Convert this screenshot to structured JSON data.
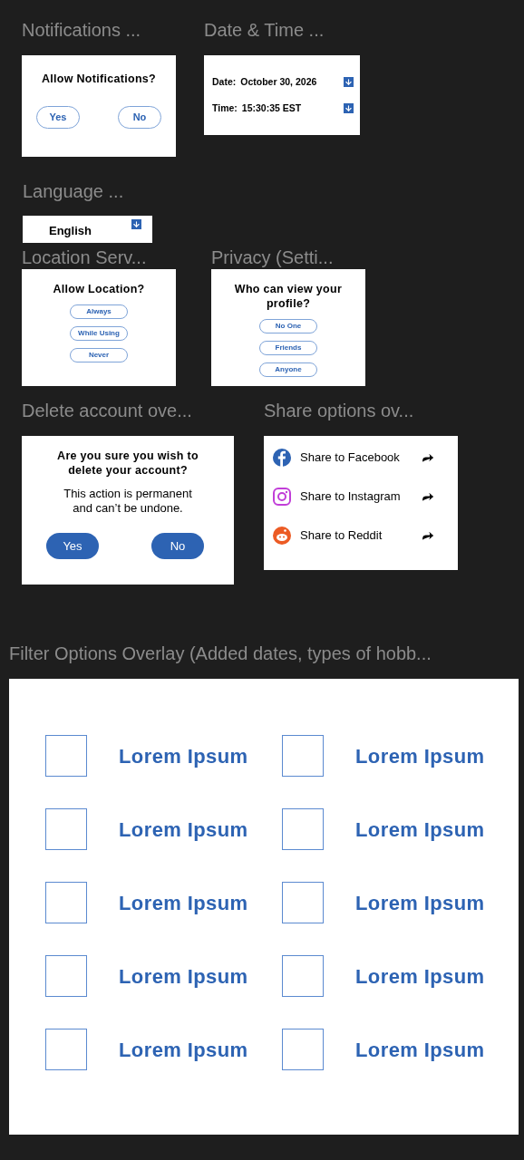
{
  "rows": [
    [
      {
        "kind": "confirm",
        "label": "Notifications ...",
        "title": "Allow Notifications?",
        "buttons": [
          "Yes",
          "No"
        ]
      },
      {
        "kind": "datetime",
        "label": "Date & Time ...",
        "fields": [
          {
            "name": "Date:",
            "value": "October 30, 2026"
          },
          {
            "name": "Time:",
            "value": "15:30:35 EST"
          }
        ]
      }
    ],
    [
      {
        "kind": "dropdown",
        "label": "Language ...",
        "value": "English"
      }
    ],
    [
      {
        "kind": "choices",
        "label": "Location Serv...",
        "title": "Allow Location?",
        "options": [
          "Always",
          "While Using",
          "Never"
        ]
      },
      {
        "kind": "choices",
        "label": "Privacy (Setti...",
        "title": "Who can view your profile?",
        "options": [
          "No One",
          "Friends",
          "Anyone"
        ]
      }
    ],
    [
      {
        "kind": "delete",
        "label": "Delete account ove...",
        "title": "Are you sure you wish to delete your account?",
        "message": "This action is permanent and can’t be undone.",
        "buttons": [
          "Yes",
          "No"
        ]
      },
      {
        "kind": "share",
        "label": "Share options ov...",
        "items": [
          {
            "kind": "facebook",
            "text": "Share to Facebook"
          },
          {
            "kind": "instagram",
            "text": "Share to Instagram"
          },
          {
            "kind": "reddit",
            "text": "Share to Reddit"
          }
        ]
      }
    ],
    [
      {
        "kind": "filter",
        "label": "Filter Options Overlay (Added dates, types of hobb...",
        "options": [
          {
            "text": "Lorem Ipsum",
            "checked": false
          },
          {
            "text": "Lorem Ipsum",
            "checked": false
          },
          {
            "text": "Lorem Ipsum",
            "checked": false
          },
          {
            "text": "Lorem Ipsum",
            "checked": false
          },
          {
            "text": "Lorem Ipsum",
            "checked": false
          },
          {
            "text": "Lorem Ipsum",
            "checked": false
          },
          {
            "text": "Lorem Ipsum",
            "checked": false
          },
          {
            "text": "Lorem Ipsum",
            "checked": false
          },
          {
            "text": "Lorem Ipsum",
            "checked": false
          },
          {
            "text": "Lorem Ipsum",
            "checked": false
          }
        ]
      }
    ]
  ]
}
